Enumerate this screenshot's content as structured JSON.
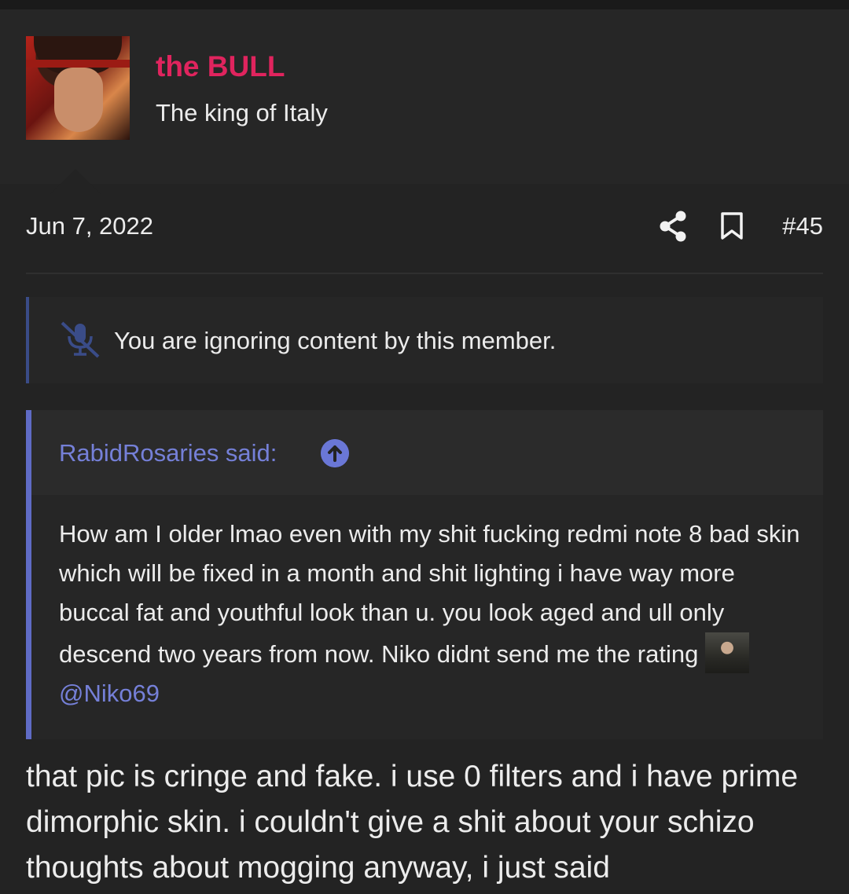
{
  "user": {
    "name": "the BULL",
    "title": "The king of Italy",
    "avatar_icon": "user-avatar"
  },
  "post": {
    "date": "Jun 7, 2022",
    "number": "#45",
    "share_icon": "share-icon",
    "bookmark_icon": "bookmark-icon"
  },
  "ignored": {
    "icon": "mute-icon",
    "text": "You are ignoring content by this member."
  },
  "quote": {
    "author": "RabidRosaries said:",
    "body": "How am I older lmao even with my shit fucking redmi note 8 bad skin which will be fixed in a month and shit lighting i have way more buccal fat and youthful look than u. you look aged and ull only descend two years from now. Niko didnt send me the rating",
    "mention": "@Niko69"
  },
  "reply": {
    "text": "that pic is cringe and fake. i use 0 filters and i have prime dimorphic skin. i couldn't give a shit about your schizo thoughts about mogging anyway, i just said"
  },
  "colors": {
    "background": "#232323",
    "username": "#e0245e",
    "quote_accent": "#5f6bc5",
    "link": "#7580d8"
  }
}
